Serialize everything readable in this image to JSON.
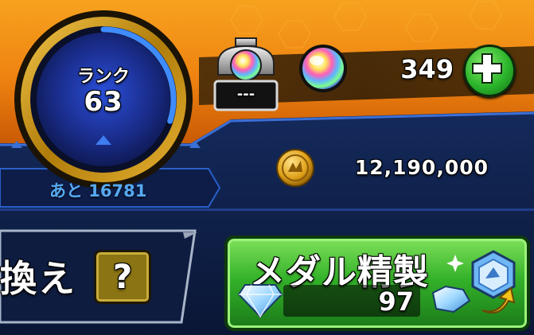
{
  "rank": {
    "label": "ランク",
    "value": "63",
    "progress": 0.3,
    "remaining_text": "あと 16781"
  },
  "slot": {
    "status_text": "---",
    "icon": "rainbow-orb-slot-icon"
  },
  "orbs": {
    "count": "349",
    "icon": "rainbow-orb-icon",
    "add_icon": "plus-icon"
  },
  "gold": {
    "amount": "12,190,000",
    "icon": "gold-coin-icon"
  },
  "exchange": {
    "label": "換え",
    "help_symbol": "?"
  },
  "medal": {
    "title": "メダル精製",
    "count": "97",
    "icon": "diamond-icon"
  },
  "colors": {
    "orange_bar": "#f08a12",
    "navy_bg": "#0b1736",
    "gold_ring": "#c9940e",
    "medal_green": "#2fae2a",
    "plus_green": "#2bb52b",
    "remaining_text": "#56a9f0"
  }
}
